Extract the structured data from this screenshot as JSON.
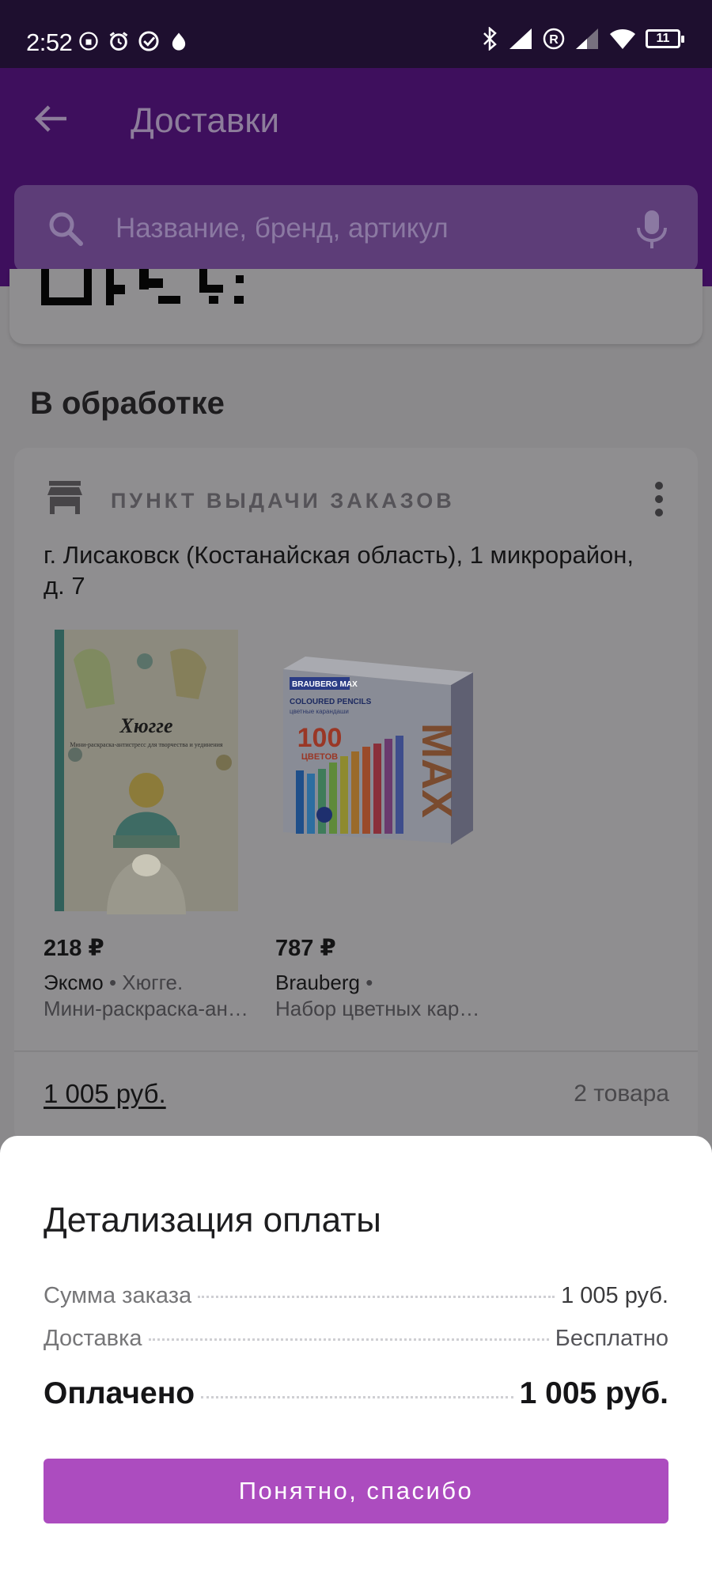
{
  "status_bar": {
    "time": "2:52",
    "battery": "11",
    "left_icons": [
      "screen-lock-rotation-icon",
      "alarm-icon",
      "check-circle-icon",
      "drop-icon"
    ],
    "right_icons": [
      "bluetooth-icon",
      "signal-icon",
      "roaming-icon",
      "signal-weak-icon",
      "wifi-icon",
      "battery-icon"
    ]
  },
  "header": {
    "title": "Доставки",
    "search_placeholder": "Название, бренд, артикул"
  },
  "section": {
    "heading": "В обработке"
  },
  "delivery": {
    "pickup_label": "ПУНКТ ВЫДАЧИ ЗАКАЗОВ",
    "address": "г. Лисаковск (Костанайская область), 1 микрорайон, д. 7",
    "products": [
      {
        "price": "218 ₽",
        "brand": "Эксмо",
        "separator": "•",
        "name_part": "Хюгге.",
        "name": "Мини-раскраска-антистресс для творчества и уединения",
        "image_title": "Хюгге",
        "image_subtitle": "Мини-раскраска-антистресс для творчества и уединения"
      },
      {
        "price": "787 ₽",
        "brand": "Brauberg",
        "separator": "•",
        "name_part": "",
        "name": "Набор цветных карандашей",
        "image_brand": "BRAUBERG MAX",
        "image_line1": "COLOURED PENCILS",
        "image_line2": "цветные карандаши",
        "image_count": "100",
        "image_count_label": "ЦВЕТОВ",
        "image_big": "MAX"
      }
    ],
    "total": "1 005 руб.",
    "items_count": "2 товара"
  },
  "payment_sheet": {
    "title": "Детализация оплаты",
    "order_sum_label": "Сумма заказа",
    "order_sum_value": "1 005 руб.",
    "delivery_label": "Доставка",
    "delivery_value": "Бесплатно",
    "paid_label": "Оплачено",
    "paid_value": "1 005 руб.",
    "button_label": "Понятно, спасибо"
  },
  "colors": {
    "accent": "#ac4cbf",
    "header_dimmed": "#3e0f5d",
    "overlay_bg": "#8a898b"
  }
}
